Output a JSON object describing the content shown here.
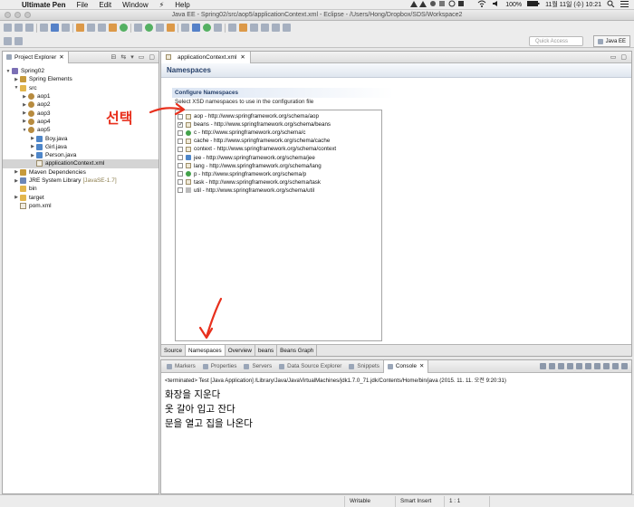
{
  "menubar": {
    "app": "Ultimate Pen",
    "items": [
      "File",
      "Edit",
      "Window",
      "Help"
    ],
    "battery": "100%",
    "datetime": "11월 11일 (수)  10:21"
  },
  "window": {
    "title": "Java EE - Spring02/src/aop5/applicationContext.xml - Eclipse - /Users/Hong/Dropbox/SDS/Workspace2"
  },
  "toolbar": {
    "quick_access_placeholder": "Quick Access",
    "perspective": "Java EE"
  },
  "explorer": {
    "tab_label": "Project Explorer",
    "tree": [
      {
        "label": "Spring02",
        "depth": 0,
        "twisty": "open",
        "icon": "project-icon"
      },
      {
        "label": "Spring Elements",
        "depth": 1,
        "twisty": "closed",
        "icon": "library-icon"
      },
      {
        "label": "src",
        "depth": 1,
        "twisty": "open",
        "icon": "source-folder-icon"
      },
      {
        "label": "aop1",
        "depth": 2,
        "twisty": "closed",
        "icon": "package-icon"
      },
      {
        "label": "aop2",
        "depth": 2,
        "twisty": "closed",
        "icon": "package-icon"
      },
      {
        "label": "aop3",
        "depth": 2,
        "twisty": "closed",
        "icon": "package-icon"
      },
      {
        "label": "aop4",
        "depth": 2,
        "twisty": "closed",
        "icon": "package-icon"
      },
      {
        "label": "aop5",
        "depth": 2,
        "twisty": "open",
        "icon": "package-icon"
      },
      {
        "label": "Boy.java",
        "depth": 3,
        "twisty": "closed",
        "icon": "java-file-icon"
      },
      {
        "label": "Girl.java",
        "depth": 3,
        "twisty": "closed",
        "icon": "java-file-icon"
      },
      {
        "label": "Person.java",
        "depth": 3,
        "twisty": "closed",
        "icon": "java-file-icon"
      },
      {
        "label": "applicationContext.xml",
        "depth": 3,
        "twisty": "none",
        "icon": "xml-file-icon",
        "selected": true
      },
      {
        "label": "Maven Dependencies",
        "depth": 1,
        "twisty": "closed",
        "icon": "library-icon"
      },
      {
        "label": "JRE System Library",
        "suffix": "[JavaSE-1.7]",
        "depth": 1,
        "twisty": "closed",
        "icon": "jre-icon"
      },
      {
        "label": "bin",
        "depth": 1,
        "twisty": "none",
        "icon": "folder-icon"
      },
      {
        "label": "target",
        "depth": 1,
        "twisty": "closed",
        "icon": "folder-icon"
      },
      {
        "label": "pom.xml",
        "depth": 1,
        "twisty": "none",
        "icon": "xml-file-icon"
      }
    ]
  },
  "editor": {
    "tab_label": "applicationContext.xml",
    "form_title": "Namespaces",
    "section_title": "Configure Namespaces",
    "section_desc": "Select XSD namespaces to use in the configuration file",
    "namespaces": [
      {
        "label": "aop - http://www.springframework.org/schema/aop",
        "checked": false,
        "icon": "aop-icon"
      },
      {
        "label": "beans - http://www.springframework.org/schema/beans",
        "checked": true,
        "icon": "beans-icon"
      },
      {
        "label": "c - http://www.springframework.org/schema/c",
        "checked": false,
        "icon": "c-namespace-icon"
      },
      {
        "label": "cache - http://www.springframework.org/schema/cache",
        "checked": false,
        "icon": "cache-icon"
      },
      {
        "label": "context - http://www.springframework.org/schema/context",
        "checked": false,
        "icon": "context-icon"
      },
      {
        "label": "jee - http://www.springframework.org/schema/jee",
        "checked": false,
        "icon": "jee-icon"
      },
      {
        "label": "lang - http://www.springframework.org/schema/lang",
        "checked": false,
        "icon": "lang-icon"
      },
      {
        "label": "p - http://www.springframework.org/schema/p",
        "checked": false,
        "icon": "p-namespace-icon"
      },
      {
        "label": "task - http://www.springframework.org/schema/task",
        "checked": false,
        "icon": "task-icon"
      },
      {
        "label": "util - http://www.springframework.org/schema/util",
        "checked": false,
        "icon": "util-icon"
      }
    ],
    "bottom_tabs": [
      "Source",
      "Namespaces",
      "Overview",
      "beans",
      "Beans Graph"
    ],
    "active_bottom_tab": "Namespaces"
  },
  "console": {
    "tabs": [
      "Markers",
      "Properties",
      "Servers",
      "Data Source Explorer",
      "Snippets",
      "Console"
    ],
    "active_tab": "Console",
    "terminated": "<terminated> Test [Java Application] /Library/Java/JavaVirtualMachines/jdk1.7.0_71.jdk/Contents/Home/bin/java (2015. 11. 11. 오전 9:20:31)",
    "output": [
      "화장을 지운다",
      "옷 갈아 입고 잔다",
      "문을 열고 집을 나온다"
    ]
  },
  "statusbar": {
    "writable": "Writable",
    "insert_mode": "Smart Insert",
    "position": "1 : 1"
  },
  "annotation": {
    "text": "선택",
    "color": "#e8301d"
  }
}
